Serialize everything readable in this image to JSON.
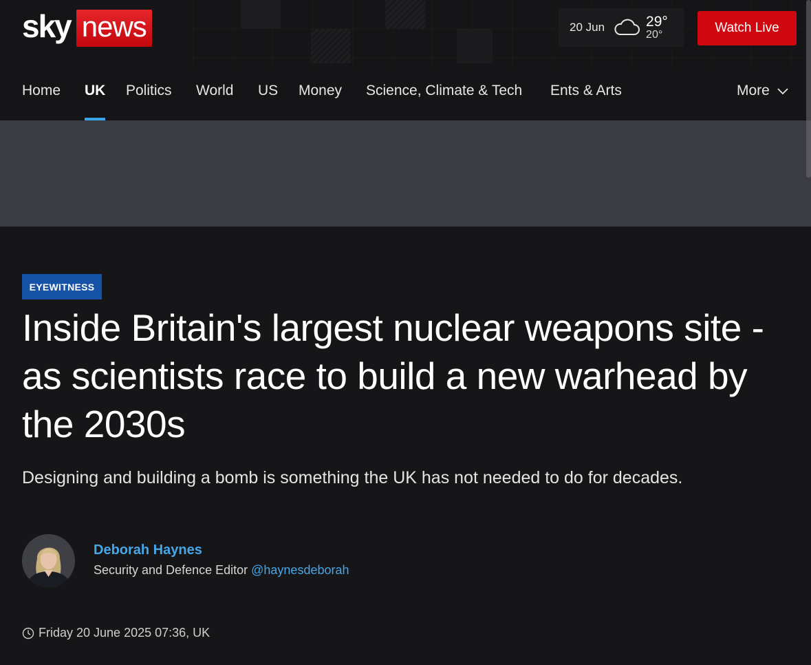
{
  "header": {
    "logo": {
      "sky": "sky",
      "news": "news"
    },
    "weather": {
      "date": "20 Jun",
      "high": "29°",
      "low": "20°",
      "icon": "cloud-icon"
    },
    "watch_live_label": "Watch Live"
  },
  "nav": {
    "items": [
      {
        "label": "Home"
      },
      {
        "label": "UK"
      },
      {
        "label": "Politics"
      },
      {
        "label": "World"
      },
      {
        "label": "US"
      },
      {
        "label": "Money"
      },
      {
        "label": "Science, Climate & Tech"
      },
      {
        "label": "Ents & Arts"
      }
    ],
    "active": "UK",
    "more_label": "More"
  },
  "article": {
    "tag": "EYEWITNESS",
    "headline": "Inside Britain's largest nuclear weapons site - as scientists race to build a new warhead by the 2030s",
    "standfirst": "Designing and building a bomb is something the UK has not needed to do for decades.",
    "author": {
      "name": "Deborah Haynes",
      "role": "Security and Defence Editor",
      "handle": "@haynesdeborah"
    },
    "timestamp": "Friday 20 June 2025 07:36, UK"
  },
  "colors": {
    "brand_red": "#d1070f",
    "accent_blue": "#3aa2e6",
    "tag_blue": "#1652a6",
    "background": "#161619"
  }
}
